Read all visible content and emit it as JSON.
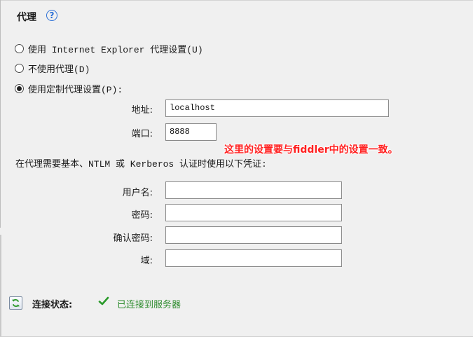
{
  "section": {
    "title": "代理",
    "help_icon": "?"
  },
  "proxy_options": [
    {
      "label": "使用 Internet Explorer 代理设置(U)",
      "selected": false
    },
    {
      "label": "不使用代理(D)",
      "selected": false
    },
    {
      "label": "使用定制代理设置(P):",
      "selected": true
    }
  ],
  "proxy_fields": {
    "address": {
      "label": "地址:",
      "value": "localhost"
    },
    "port": {
      "label": "端口:",
      "value": "8888"
    }
  },
  "annotation": "这里的设置要与fiddler中的设置一致。",
  "credentials": {
    "description": "在代理需要基本、NTLM 或 Kerberos 认证时使用以下凭证:",
    "username": {
      "label": "用户名:",
      "value": ""
    },
    "password": {
      "label": "密码:",
      "value": ""
    },
    "confirm_password": {
      "label": "确认密码:",
      "value": ""
    },
    "domain": {
      "label": "域:",
      "value": ""
    }
  },
  "status": {
    "label": "连接状态:",
    "value": "已连接到服务器",
    "value_color": "#2a8a2a",
    "icon": "check-icon"
  },
  "colors": {
    "annotation": "#ff2020",
    "help_accent": "#2a6fd6"
  }
}
